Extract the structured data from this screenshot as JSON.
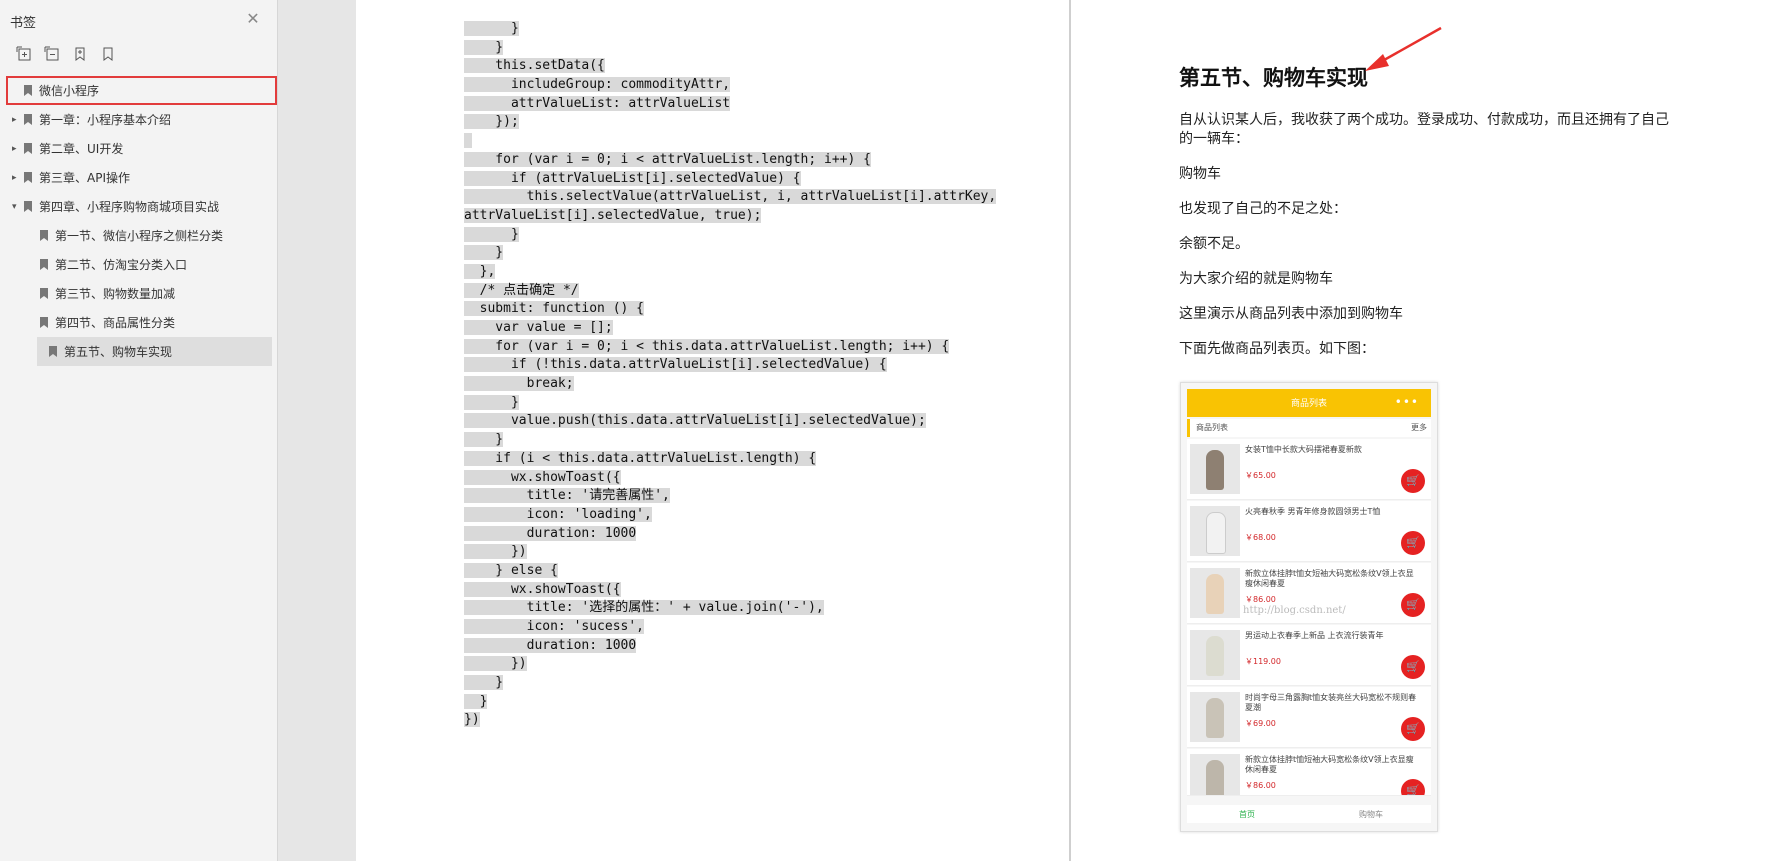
{
  "sidebar": {
    "title": "书签",
    "close_glyph": "✕",
    "toolbar": [
      "expand-all-icon",
      "collapse-all-icon",
      "add-bookmark-icon",
      "bookmark-icon"
    ],
    "items": [
      {
        "label": "微信小程序",
        "arrow": "none",
        "level": 1,
        "highlight": true
      },
      {
        "label": "第一章：小程序基本介绍",
        "arrow": "▸",
        "level": 1
      },
      {
        "label": "第二章、UI开发",
        "arrow": "▸",
        "level": 1
      },
      {
        "label": "第三章、API操作",
        "arrow": "▸",
        "level": 1
      },
      {
        "label": "第四章、小程序购物商城项目实战",
        "arrow": "▾",
        "level": 1
      },
      {
        "label": "第一节、微信小程序之侧栏分类",
        "arrow": "none",
        "level": 2
      },
      {
        "label": "第二节、仿淘宝分类入口",
        "arrow": "none",
        "level": 2
      },
      {
        "label": "第三节、购物数量加减",
        "arrow": "none",
        "level": 2
      },
      {
        "label": "第四节、商品属性分类",
        "arrow": "none",
        "level": 2
      },
      {
        "label": "第五节、购物车实现",
        "arrow": "none",
        "level": 2,
        "selected": true
      }
    ]
  },
  "left_page": {
    "code_lines": [
      "      }",
      "    }",
      "    this.setData({",
      "      includeGroup: commodityAttr,",
      "      attrValueList: attrValueList",
      "    });",
      "",
      "    for (var i = 0; i < attrValueList.length; i++) {",
      "      if (attrValueList[i].selectedValue) {",
      "        this.selectValue(attrValueList, i, attrValueList[i].attrKey,",
      "attrValueList[i].selectedValue, true);",
      "      }",
      "    }",
      "  },",
      "  /* 点击确定 */",
      "  submit: function () {",
      "    var value = [];",
      "    for (var i = 0; i < this.data.attrValueList.length; i++) {",
      "      if (!this.data.attrValueList[i].selectedValue) {",
      "        break;",
      "      }",
      "      value.push(this.data.attrValueList[i].selectedValue);",
      "    }",
      "    if (i < this.data.attrValueList.length) {",
      "      wx.showToast({",
      "        title: '请完善属性',",
      "        icon: 'loading',",
      "        duration: 1000",
      "      })",
      "    } else {",
      "      wx.showToast({",
      "        title: '选择的属性：' + value.join('-'),",
      "        icon: 'sucess',",
      "        duration: 1000",
      "      })",
      "    }",
      "  }",
      "})"
    ]
  },
  "right_page": {
    "heading": "第五节、购物车实现",
    "paragraphs": [
      "自从认识某人后，我收获了两个成功。登录成功、付款成功，而且还拥有了自己的一辆车：",
      "购物车",
      "也发现了自己的不足之处：",
      "余额不足。",
      "为大家介绍的就是购物车",
      "这里演示从商品列表中添加到购物车",
      "下面先做商品列表页。如下图："
    ],
    "phone": {
      "bar_title": "商品列表",
      "dots": "•••",
      "list_header": "商品列表",
      "more": "更多",
      "items": [
        {
          "name": "女装T恤中长款大码摆裙春夏新款",
          "price": "￥65.00"
        },
        {
          "name": "火亮春秋季 男青年修身款圆领男士T恤",
          "price": "￥68.00"
        },
        {
          "name": "新款立体挂脖t恤女短袖大码宽松条纹V领上衣显瘦休闲春夏",
          "price": "￥86.00"
        },
        {
          "name": "男运动上衣春季上新品 上衣流行装青年",
          "price": "￥119.00"
        },
        {
          "name": "时尚字母三角露胸t恤女装亮丝大码宽松不规则春夏潮",
          "price": "￥69.00"
        },
        {
          "name": "新款立体挂脖t恤短袖大码宽松条纹V领上衣显瘦休闲春夏",
          "price": "￥86.00"
        }
      ],
      "watermark": "http://blog.csdn.net/",
      "tab_home": "首页",
      "tab_cart": "购物车"
    }
  },
  "colors": {
    "accent_red": "#e23b3b",
    "phone_yellow": "#f9c303",
    "cart_red": "#e52222"
  }
}
